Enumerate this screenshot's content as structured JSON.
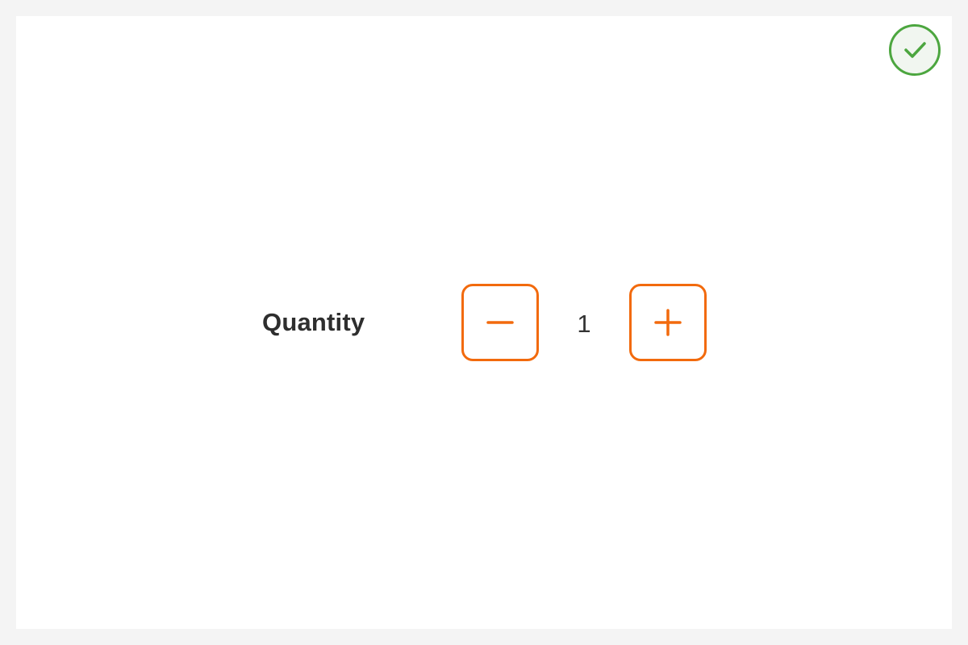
{
  "quantity": {
    "label": "Quantity",
    "value": "1",
    "decrement_icon": "minus-icon",
    "increment_icon": "plus-icon"
  },
  "confirm": {
    "icon": "check-icon",
    "color": "#4ca63f"
  },
  "colors": {
    "accent": "#f26a0d",
    "text": "#2e2e2e",
    "background": "#f4f4f4",
    "panel": "#ffffff"
  }
}
